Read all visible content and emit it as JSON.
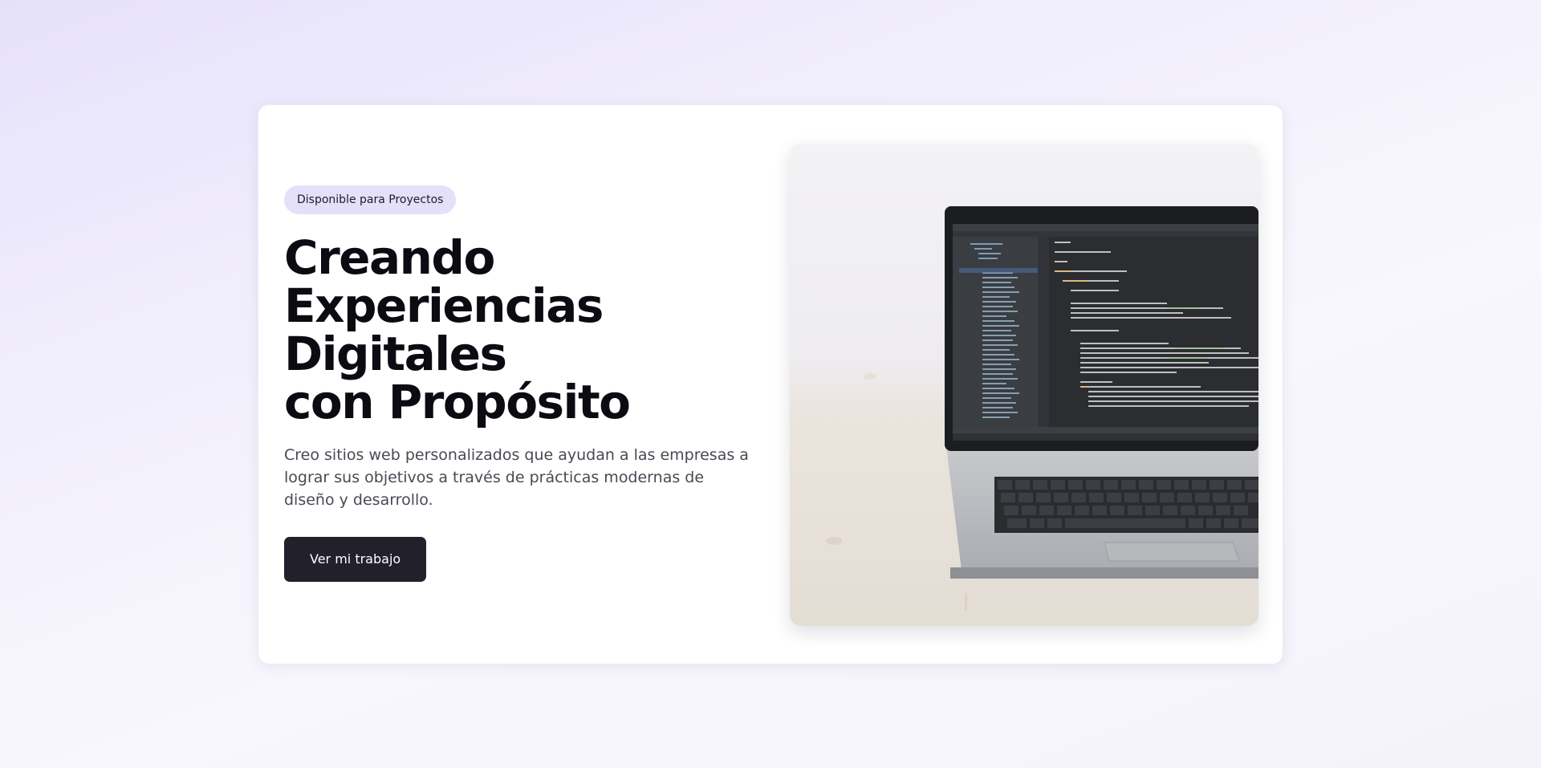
{
  "hero": {
    "badge": "Disponible para Proyectos",
    "headline_lines": [
      "Creando",
      "Experiencias",
      "Digitales",
      "con Propósito"
    ],
    "description": "Creo sitios web personalizados que ayudan a las empresas a lograr sus objetivos a través de prácticas modernas de diseño y desarrollo.",
    "cta_label": "Ver mi trabajo",
    "image_alt": "laptop-with-code-editor"
  },
  "colors": {
    "badge_bg": "#e4e0fa",
    "cta_bg": "#22202b",
    "headline": "#0b0b12",
    "body_text": "#4a4853",
    "page_gradient_start": "#e6e1fb"
  }
}
